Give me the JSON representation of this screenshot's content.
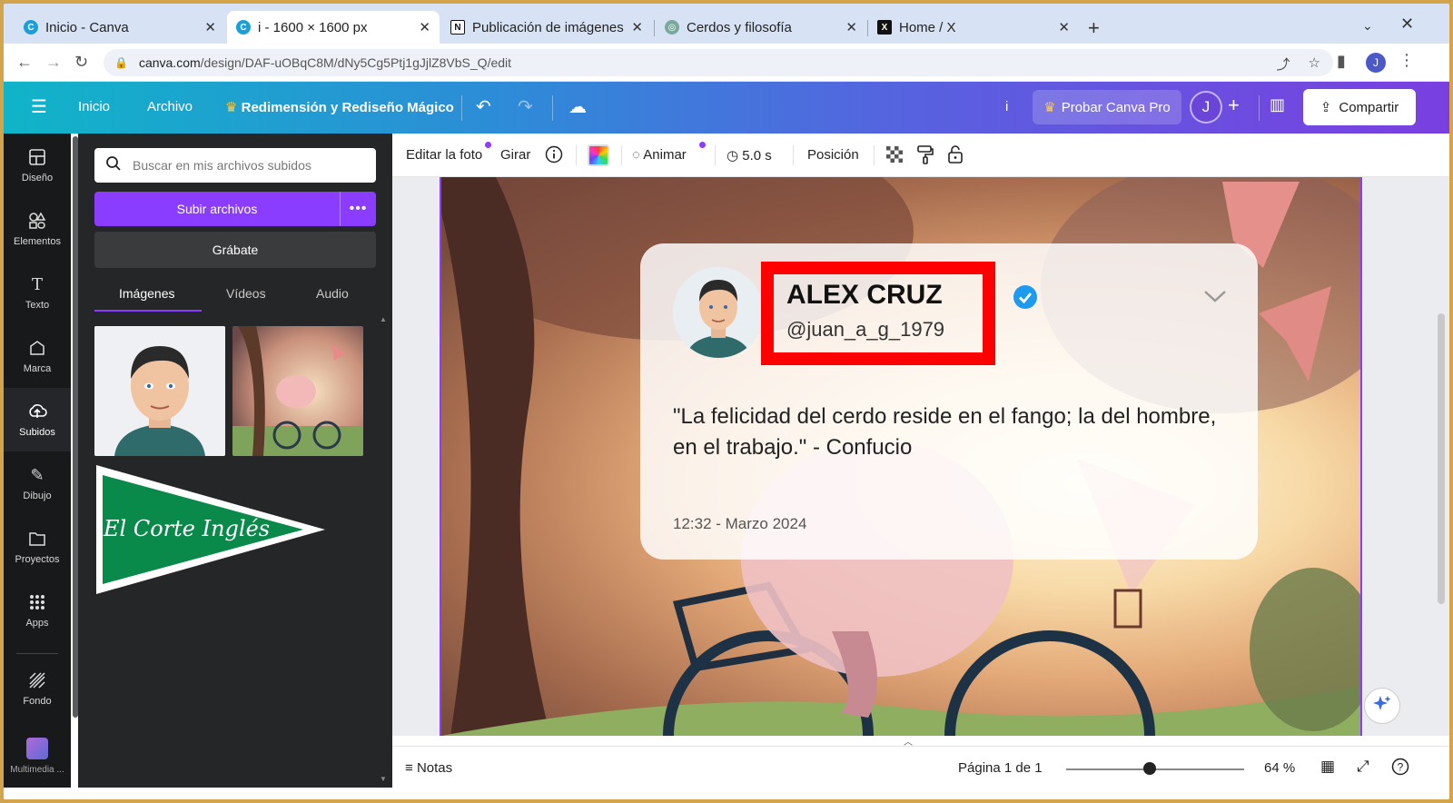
{
  "browser": {
    "tabs": [
      {
        "label": "Inicio - Canva",
        "icon": "canva-icon",
        "active": false
      },
      {
        "label": "i - 1600 × 1600 px",
        "icon": "canva-icon",
        "active": true
      },
      {
        "label": "Publicación de imágenes",
        "icon": "notion-icon",
        "active": false
      },
      {
        "label": "Cerdos y filosofía",
        "icon": "chatgpt-icon",
        "active": false
      },
      {
        "label": "Home / X",
        "icon": "x-icon",
        "active": false
      }
    ],
    "url_host": "canva.com",
    "url_path": "/design/DAF-uOBqC8M/dNy5Cg5Ptj1gJjlZ8VbS_Q/edit",
    "profile_initial": "J"
  },
  "canva_header": {
    "home": "Inicio",
    "file": "Archivo",
    "magic_resize": "Redimensión y Rediseño Mágico",
    "title_short": "i",
    "try_pro": "Probar Canva Pro",
    "user_initial": "J",
    "share": "Compartir"
  },
  "rail": {
    "items": [
      "Diseño",
      "Elementos",
      "Texto",
      "Marca",
      "Subidos",
      "Dibujo",
      "Proyectos",
      "Apps",
      "Fondo",
      "Multimedia ..."
    ],
    "active": "Subidos"
  },
  "panel": {
    "search_placeholder": "Buscar en mis archivos subidos",
    "upload_button": "Subir archivos",
    "record_button": "Grábate",
    "tabs": [
      "Imágenes",
      "Vídeos",
      "Audio"
    ],
    "active_tab": "Imágenes",
    "logo_text": "El Corte Inglés"
  },
  "toolbar": {
    "edit_photo": "Editar la foto",
    "rotate": "Girar",
    "animate": "Animar",
    "duration": "5.0 s",
    "position": "Posición"
  },
  "post": {
    "name": "ALEX CRUZ",
    "handle": "@juan_a_g_1979",
    "quote": "\"La felicidad del cerdo reside en el fango; la del hombre, en el trabajo.\" - Confucio",
    "timestamp": "12:32 - Marzo 2024"
  },
  "bottom": {
    "notes": "Notas",
    "page": "Página 1 de 1",
    "zoom": "64 %",
    "zoom_level": 64
  },
  "colors": {
    "canva_purple": "#8b3dff",
    "highlight_red": "#ff0000",
    "verified_blue": "#1d9bf0"
  }
}
